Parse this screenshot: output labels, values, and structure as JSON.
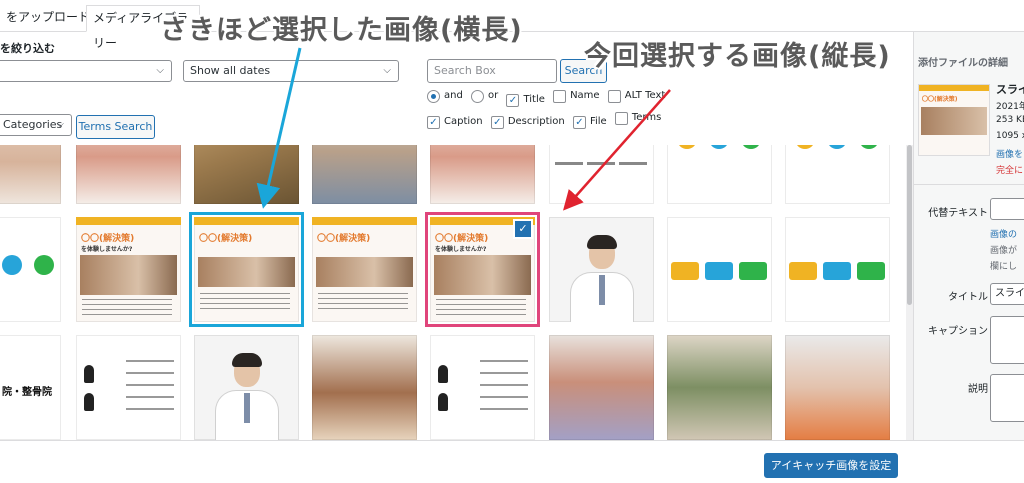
{
  "tabs": {
    "upload": "をアップロード",
    "library": "メディアライブラリー"
  },
  "filters": {
    "label": "を絞り込む",
    "type_select": "",
    "date_select": "Show all dates",
    "category_select": "Categories",
    "terms_button": "Terms Search",
    "search_placeholder": "Search Box",
    "search_button": "Search",
    "options_row1": [
      {
        "kind": "radio",
        "label": "and",
        "checked": true
      },
      {
        "kind": "radio",
        "label": "or",
        "checked": false
      },
      {
        "kind": "checkbox",
        "label": "Title",
        "checked": true
      },
      {
        "kind": "checkbox",
        "label": "Name",
        "checked": false
      },
      {
        "kind": "checkbox",
        "label": "ALT Text",
        "checked": false
      }
    ],
    "options_row2": [
      {
        "kind": "checkbox",
        "label": "Caption",
        "checked": true
      },
      {
        "kind": "checkbox",
        "label": "Description",
        "checked": true
      },
      {
        "kind": "checkbox",
        "label": "File",
        "checked": true
      },
      {
        "kind": "checkbox",
        "label": "Terms",
        "checked": false
      }
    ]
  },
  "poster_text": {
    "headline": "〇〇(解決策)",
    "sub": "を体験しませんか?"
  },
  "clinic_text": "院・整骨院",
  "sidebar": {
    "header": "添付ファイルの詳細",
    "title": "スライ",
    "line1": "2021年",
    "line2": "253 KB",
    "line3": "1095 x",
    "edit_link": "画像を",
    "delete_link": "完全に",
    "alt_label": "代替テキスト",
    "alt_hint_link": "画像の",
    "alt_hint1": "画像が",
    "alt_hint2": "欄にし",
    "title_label": "タイトル",
    "title_value": "スライ",
    "caption_label": "キャプション",
    "description_label": "説明"
  },
  "footer": {
    "primary_button": "アイキャッチ画像を設定"
  },
  "annotations": {
    "previous": "さきほど選択した画像(横長)",
    "current": "今回選択する画像(縦長)"
  },
  "colors": {
    "accent": "#2271b1",
    "annotation_blue": "#1aa6d9",
    "annotation_red": "#e0457b"
  }
}
